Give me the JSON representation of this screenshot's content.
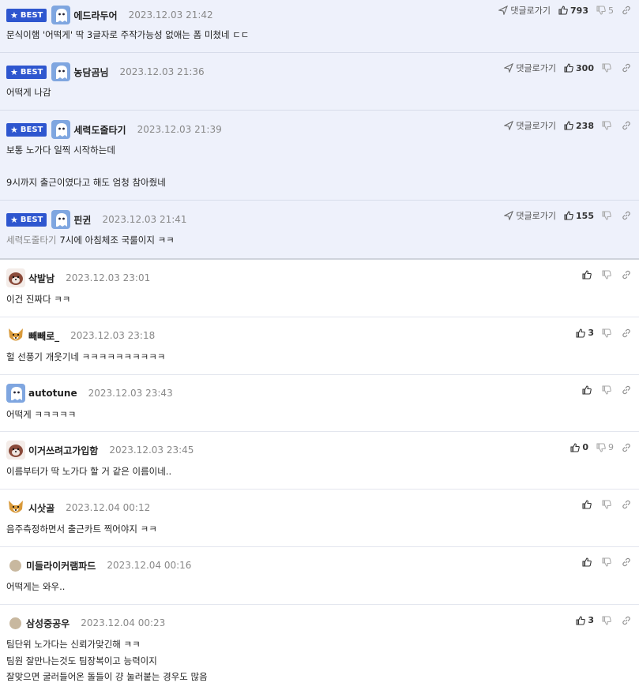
{
  "labels": {
    "best": "BEST",
    "reply": "댓글로가기"
  },
  "best_comments": [
    {
      "author": "에드라두어",
      "date": "2023.12.03 21:42",
      "up": "793",
      "down": "5",
      "body": [
        "문식이햄 '어떡게' 딱 3글자로 주작가능성 없애는 폼 미쳤네 ㄷㄷ"
      ]
    },
    {
      "author": "농담곰님",
      "date": "2023.12.03 21:36",
      "up": "300",
      "down": "",
      "body": [
        "어떡게 나감"
      ]
    },
    {
      "author": "세력도줄타기",
      "date": "2023.12.03 21:39",
      "up": "238",
      "down": "",
      "body": [
        "보통 노가다 일찍 시작하는데",
        "",
        "9시까지 출근이였다고 해도 엄청 참아줬네"
      ]
    },
    {
      "author": "핀귄",
      "date": "2023.12.03 21:41",
      "up": "155",
      "down": "",
      "mention": "세력도줄타기",
      "body": [
        "7시에 아침체조 국룰이지 ㅋㅋ"
      ]
    }
  ],
  "comments": [
    {
      "author": "삭발남",
      "date": "2023.12.03 23:01",
      "up": "",
      "down": "",
      "avatar": "dog-brown",
      "body": [
        "이건 진짜다 ㅋㅋ"
      ]
    },
    {
      "author": "빼빼로_",
      "date": "2023.12.03 23:18",
      "up": "3",
      "down": "",
      "avatar": "corgi",
      "body": [
        "헐 선풍기 개웃기네 ㅋㅋㅋㅋㅋㅋㅋㅋㅋㅋ"
      ]
    },
    {
      "author": "autotune",
      "date": "2023.12.03 23:43",
      "up": "",
      "down": "",
      "avatar": "blue-ghost",
      "body": [
        "어떡게 ㅋㅋㅋㅋㅋ"
      ]
    },
    {
      "author": "이거쓰려고가입함",
      "date": "2023.12.03 23:45",
      "up": "0",
      "down": "9",
      "avatar": "dog-brown",
      "body": [
        "이름부터가 딱 노가다 할 거 같은 이름이네.."
      ]
    },
    {
      "author": "시삿골",
      "date": "2023.12.04 00:12",
      "up": "",
      "down": "",
      "avatar": "corgi",
      "body": [
        "음주측정하면서 출근카트 찍어야지 ㅋㅋ"
      ]
    },
    {
      "author": "미들라이커램파드",
      "date": "2023.12.04 00:16",
      "up": "",
      "down": "",
      "avatar": "dot",
      "body": [
        "어떡게는 와우.."
      ]
    },
    {
      "author": "삼성중공우",
      "date": "2023.12.04 00:23",
      "up": "3",
      "down": "",
      "avatar": "dot",
      "body": [
        "팀단위 노가다는 신뢰가맞긴해 ㅋㅋ",
        "팀원 잘만나는것도 팀장복이고 능력이지",
        "잘맞으면 굴러들어온 돌들이 걍 눌러붙는 경우도 많음"
      ]
    }
  ]
}
